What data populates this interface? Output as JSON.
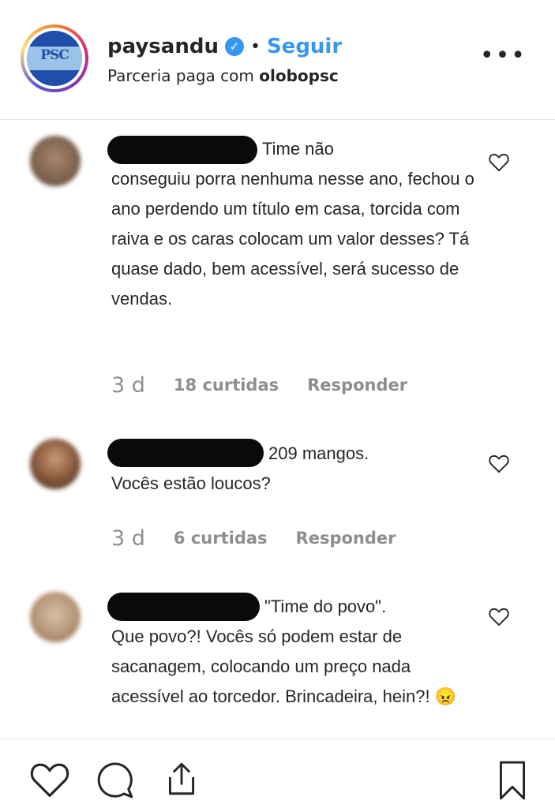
{
  "post_header": {
    "username": "paysandu",
    "verified_icon": "verified-badge-icon",
    "separator": "•",
    "follow_label": "Seguir",
    "partnership_prefix": "Parceria paga com",
    "partner_name": "olobopsc",
    "more_label": "•••",
    "avatar_monogram": "PSC"
  },
  "comments": [
    {
      "first_line": "Time não",
      "rest": "conseguiu porra nenhuma nesse ano, fechou o ano perdendo um título em casa, torcida com raiva e os caras colocam um valor desses? Tá quase dado, bem acessível, será sucesso de vendas.",
      "time": "3 d",
      "likes": "18 curtidas",
      "reply_label": "Responder"
    },
    {
      "first_line": "209 mangos.",
      "rest": "Vocês estão loucos?",
      "time": "3 d",
      "likes": "6 curtidas",
      "reply_label": "Responder"
    },
    {
      "first_line": "\"Time do povo\".",
      "rest": "Que povo?! Vocês só podem estar de sacanagem, colocando um preço nada acessível ao torcedor. Brincadeira, hein?! 😠"
    }
  ],
  "actions": {
    "like_icon": "heart-icon",
    "comment_icon": "comment-bubble-icon",
    "share_icon": "share-icon",
    "save_icon": "bookmark-icon"
  },
  "colors": {
    "accent": "#3897f0",
    "text": "#262626",
    "muted": "#8e8e8e",
    "divider": "#e6e6e6"
  }
}
